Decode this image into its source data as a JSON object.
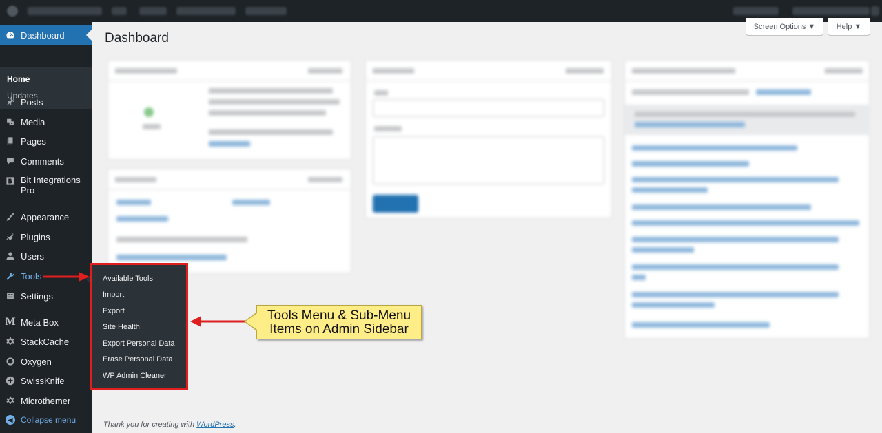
{
  "sidebar": {
    "dashboard": "Dashboard",
    "home": "Home",
    "updates": "Updates",
    "items": [
      {
        "label": "Posts",
        "icon": "pin-icon"
      },
      {
        "label": "Media",
        "icon": "media-icon"
      },
      {
        "label": "Pages",
        "icon": "pages-icon"
      },
      {
        "label": "Comments",
        "icon": "comments-icon"
      },
      {
        "label": "Bit Integrations Pro",
        "icon": "bit-integrations-icon"
      },
      {
        "label": "Appearance",
        "icon": "brush-icon"
      },
      {
        "label": "Plugins",
        "icon": "plug-icon"
      },
      {
        "label": "Users",
        "icon": "user-icon"
      },
      {
        "label": "Tools",
        "icon": "wrench-icon"
      },
      {
        "label": "Settings",
        "icon": "settings-icon"
      },
      {
        "label": "Meta Box",
        "icon": "metabox-icon"
      },
      {
        "label": "StackCache",
        "icon": "gear-icon"
      },
      {
        "label": "Oxygen",
        "icon": "oxygen-icon"
      },
      {
        "label": "SwissKnife",
        "icon": "plus-circle-icon"
      },
      {
        "label": "Microthemer",
        "icon": "gear-icon"
      }
    ],
    "collapse": "Collapse menu"
  },
  "tools_flyout": [
    "Available Tools",
    "Import",
    "Export",
    "Site Health",
    "Export Personal Data",
    "Erase Personal Data",
    "WP Admin Cleaner"
  ],
  "header": {
    "title": "Dashboard",
    "screen_options": "Screen Options ▼",
    "help": "Help ▼"
  },
  "footer": {
    "text": "Thank you for creating with ",
    "link": "WordPress",
    "end": "."
  },
  "annotation": {
    "line1": "Tools Menu & Sub-Menu",
    "line2": "Items on Admin Sidebar"
  },
  "colors": {
    "admin_dark": "#1d2327",
    "admin_blue": "#2271b1",
    "highlight_red": "#e01e1e",
    "callout_yellow": "#ffee88"
  }
}
